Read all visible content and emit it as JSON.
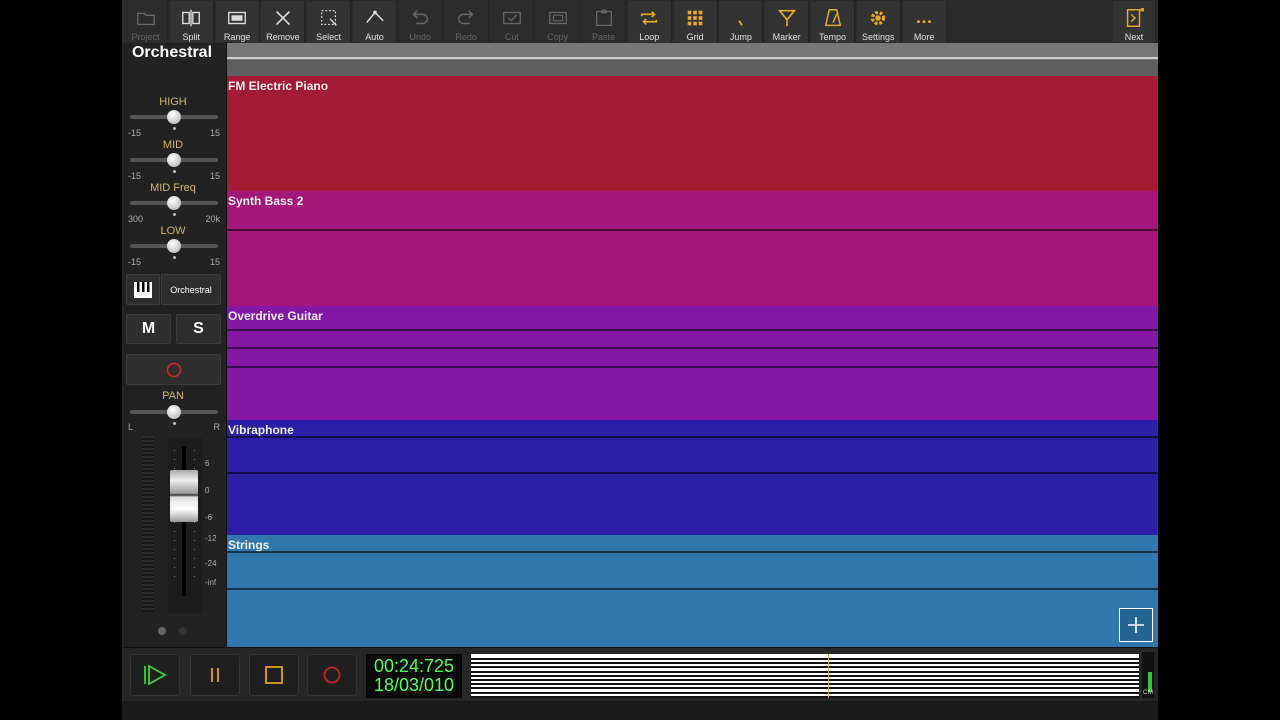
{
  "toolbar": {
    "buttons": [
      {
        "label": "Project",
        "icon": "folder-icon",
        "enabled": false
      },
      {
        "label": "Split",
        "icon": "split-icon",
        "enabled": true
      },
      {
        "label": "Range",
        "icon": "range-icon",
        "enabled": true
      },
      {
        "label": "Remove",
        "icon": "remove-x-icon",
        "enabled": true
      },
      {
        "label": "Select",
        "icon": "select-icon",
        "enabled": true
      },
      {
        "label": "Auto",
        "icon": "automation-icon",
        "enabled": true
      },
      {
        "label": "Undo",
        "icon": "undo-icon",
        "enabled": false
      },
      {
        "label": "Redo",
        "icon": "redo-icon",
        "enabled": false
      },
      {
        "label": "Cut",
        "icon": "cut-icon",
        "enabled": false
      },
      {
        "label": "Copy",
        "icon": "copy-icon",
        "enabled": false
      },
      {
        "label": "Paste",
        "icon": "paste-icon",
        "enabled": false
      },
      {
        "label": "Loop",
        "icon": "loop-icon",
        "enabled": true
      },
      {
        "label": "Grid",
        "icon": "grid-icon",
        "enabled": true
      },
      {
        "label": "Jump",
        "icon": "jump-icon",
        "enabled": true
      },
      {
        "label": "Marker",
        "icon": "marker-icon",
        "enabled": true
      },
      {
        "label": "Tempo",
        "icon": "metronome-icon",
        "enabled": true
      },
      {
        "label": "Settings",
        "icon": "gear-icon",
        "enabled": true
      },
      {
        "label": "More",
        "icon": "more-dots-icon",
        "enabled": true
      }
    ],
    "next_label": "Next"
  },
  "panel": {
    "track_name": "Orchestral",
    "eq": [
      {
        "label": "HIGH",
        "min": "-15",
        "max": "15",
        "value": 0.5
      },
      {
        "label": "MID",
        "min": "-15",
        "max": "15",
        "value": 0.5
      },
      {
        "label": "MID Freq",
        "min": "300",
        "max": "20k",
        "value": 0.5
      },
      {
        "label": "LOW",
        "min": "-15",
        "max": "15",
        "value": 0.5
      }
    ],
    "instrument_label": "Orchestral",
    "mute_label": "M",
    "solo_label": "S",
    "pan": {
      "label": "PAN",
      "left": "L",
      "right": "R",
      "value": 0.5
    },
    "fader_scale": [
      "6",
      "0",
      "-6",
      "-12",
      "-24",
      "-inf"
    ]
  },
  "tracks": [
    {
      "name": "FM Electric Piano",
      "color": "#a21a33"
    },
    {
      "name": "Synth Bass 2",
      "color": "#a3177a"
    },
    {
      "name": "Overdrive Guitar",
      "color": "#8517a7"
    },
    {
      "name": "Vibraphone",
      "color": "#2b1fa5"
    },
    {
      "name": "Strings",
      "color": "#2f77ac"
    }
  ],
  "transport": {
    "time": "00:24:725",
    "position": "18/03/010",
    "play_color": "#3fcf3f",
    "record_color": "#c22222",
    "meter_labels": [
      "C",
      "M"
    ]
  }
}
